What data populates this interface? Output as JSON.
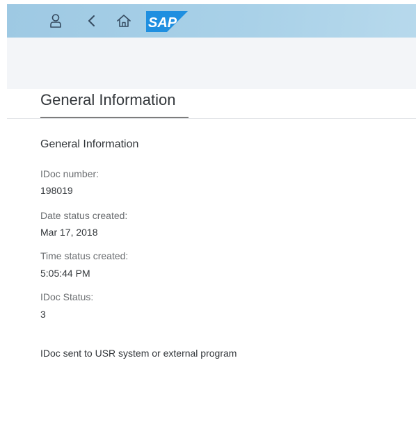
{
  "header": {
    "icons": [
      "user-icon",
      "back-icon",
      "home-icon"
    ],
    "logo_text": "SAP",
    "colors": {
      "bar": "#a9d1e8",
      "logo": "#1f8fe0"
    }
  },
  "page": {
    "title": "General Information"
  },
  "section": {
    "title": "General Information",
    "fields": [
      {
        "label": "IDoc number:",
        "value": "198019"
      },
      {
        "label": "Date status created:",
        "value": "Mar 17, 2018"
      },
      {
        "label": "Time status created:",
        "value": "5:05:44 PM"
      },
      {
        "label": "IDoc Status:",
        "value": "3"
      }
    ],
    "status_description": "IDoc sent to USR system or external program"
  }
}
